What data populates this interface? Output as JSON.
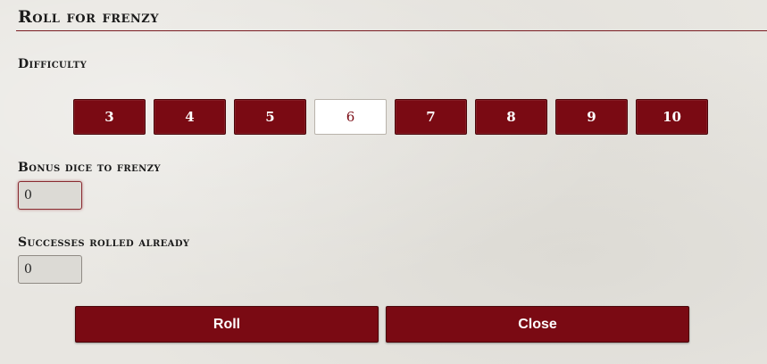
{
  "dialog": {
    "title": "Roll for frenzy"
  },
  "difficulty": {
    "label": "Difficulty",
    "options": [
      "3",
      "4",
      "5",
      "6",
      "7",
      "8",
      "9",
      "10"
    ],
    "selected": "6"
  },
  "bonus_dice": {
    "label": "Bonus dice to frenzy",
    "value": "0"
  },
  "successes": {
    "label": "Successes rolled already",
    "value": "0"
  },
  "actions": {
    "roll_label": "Roll",
    "close_label": "Close"
  },
  "colors": {
    "accent": "#7a0a13",
    "background": "#e8e6e1"
  }
}
